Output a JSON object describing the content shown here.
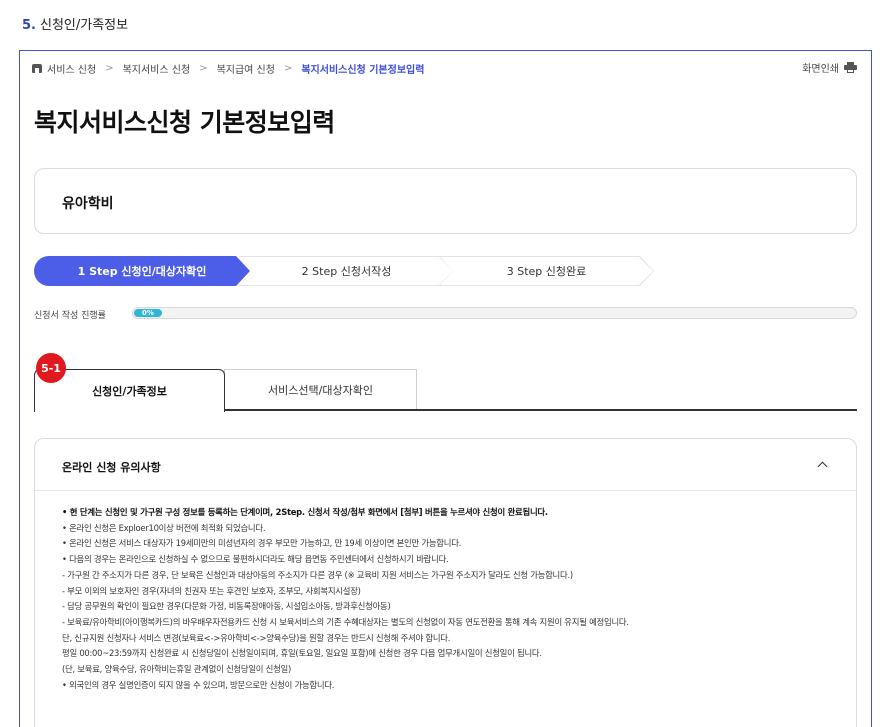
{
  "section_heading": {
    "number": "5.",
    "title": "신청인/가족정보"
  },
  "breadcrumb": {
    "items": [
      "서비스 신청",
      "복지서비스 신청",
      "복지급여 신청"
    ],
    "current": "복지서비스신청 기본정보입력",
    "separator": ">"
  },
  "print": {
    "label": "화면인쇄",
    "icon": "printer-icon"
  },
  "page_title": "복지서비스신청 기본정보입력",
  "service": {
    "name": "유아학비"
  },
  "steps": [
    {
      "label": "1 Step 신청인/대상자확인",
      "active": true
    },
    {
      "label": "2 Step 신청서작성",
      "active": false
    },
    {
      "label": "3 Step 신청완료",
      "active": false
    }
  ],
  "progress": {
    "label": "신청서 작성 진행률",
    "value_text": "0%",
    "value": 0
  },
  "badge": "5-1",
  "tabs": [
    {
      "label": "신청인/가족정보",
      "active": true
    },
    {
      "label": "서비스선택/대상자확인",
      "active": false
    }
  ],
  "notice": {
    "title": "온라인 신청 유의사항",
    "lines": [
      "• 현 단계는 신청인 및 가구원 구성 정보를 등록하는 단계이며, 2Step. 신청서 작성/첨부 화면에서 [첨부] 버튼을 누르셔야 신청이 완료됩니다.",
      "• 온라인 신청은 Exploer10이상 버전에 최적화 되었습니다.",
      "• 온라인 신청은 서비스 대상자가 19세미만의 미성년자의 경우 부모만 가능하고, 만 19세 이상이면 본인만 가능합니다.",
      "• 다음의 경우는 온라인으로 신청하실 수 없으므로 불편하시더라도 해당 읍면동 주민센터에서 신청하시기 바랍니다.",
      "  - 가구원 간 주소지가 다른 경우, 단 보육은 신청인과 대상아동의 주소지가 다른 경우 (※ 교육비 지원 서비스는 가구원 주소지가 달라도 신청 가능합니다.)",
      "  - 부모 이외의 보호자인 경우(자녀의 친권자 또는 후견인 보호자, 조부모, 사회복지시설장)",
      "  - 담당 공무원의 확인이 필요한 경우(다문화 가정, 비동록장애아동, 시설입소아동, 방과후신청아동)",
      "  - 보육료/유아학비(아이행복카드)의 바우배우자전용카드 신청 시 보육서비스의 기존 수혜대상자는 별도의 신청없이 자동 연도전환을 통해 계속 지원이 유지될 예정입니다.",
      "    단, 신규지원 신청자나 서비스 변경(보육료<->유아학비<->양육수당)을 원할 경우는 반드시 신청해 주셔야 합니다.",
      "    평일 00:00~23:59까지 신청완료 시 신청당일이 신청일이되며, 휴일(토요일, 일요일 포함)에 신청한 경우 다음 업무개시일이 신청일이 됩니다.",
      "    (단, 보육료, 양육수당, 유아학비는휴일 관계없이 신청당일이 신청일)",
      "• 외국인의 경우 실명인증이 되지 않을 수 있으며, 방문으로만 신청이 가능합니다."
    ]
  },
  "colors": {
    "accent": "#4c5ee8",
    "badge": "#e0191e",
    "progress": "#30b6d5",
    "frame": "#3f57c4"
  }
}
